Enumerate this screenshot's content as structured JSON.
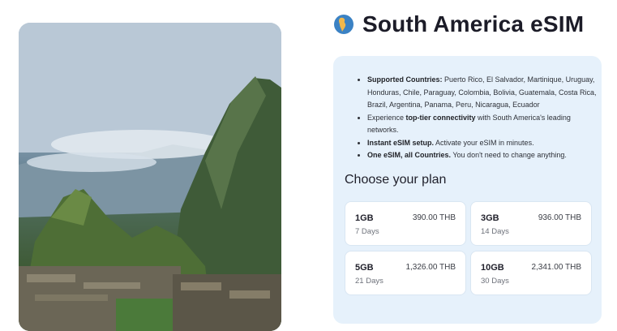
{
  "header": {
    "title": "South America eSIM",
    "icon": "globe-americas-icon"
  },
  "hero": {
    "icon": "machu-picchu-photo"
  },
  "features": [
    {
      "bold": "Supported Countries:",
      "text": " Puerto Rico, El Salvador, Martinique, Uruguay, Honduras, Chile, Paraguay, Colombia, Bolivia, Guatemala, Costa Rica, Brazil, Argentina, Panama, Peru, Nicaragua, Ecuador",
      "pre": ""
    },
    {
      "pre": "Experience ",
      "bold": "top-tier connectivity",
      "text": " with South America's leading networks."
    },
    {
      "pre": "",
      "bold": "Instant eSIM setup.",
      "text": " Activate your eSIM in minutes."
    },
    {
      "pre": "",
      "bold": "One eSIM, all Countries.",
      "text": " You don't need to change anything."
    }
  ],
  "plans_title": "Choose your plan",
  "plans": [
    {
      "data": "1GB",
      "price": "390.00 THB",
      "days": "7 Days"
    },
    {
      "data": "3GB",
      "price": "936.00 THB",
      "days": "14 Days"
    },
    {
      "data": "5GB",
      "price": "1,326.00 THB",
      "days": "21 Days"
    },
    {
      "data": "10GB",
      "price": "2,341.00 THB",
      "days": "30 Days"
    }
  ],
  "colors": {
    "panel": "#e6f1fb",
    "accent_blue": "#3b82c4"
  }
}
